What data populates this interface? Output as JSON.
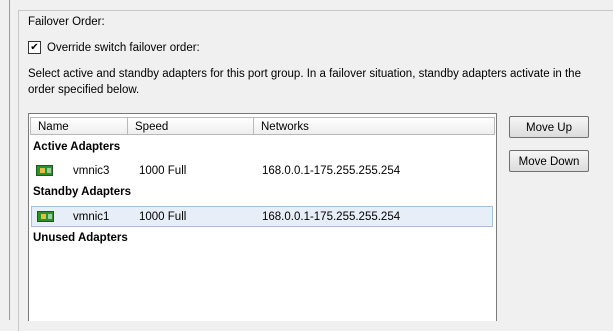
{
  "failover": {
    "title": "Failover Order:",
    "override_checked_glyph": "✔",
    "override_label": "Override switch failover order:",
    "description": "Select active and standby adapters for this port group.  In a failover situation, standby adapters activate  in the order specified below."
  },
  "table": {
    "columns": [
      "Name",
      "Speed",
      "Networks"
    ],
    "groups": {
      "active": "Active Adapters",
      "standby": "Standby Adapters",
      "unused": "Unused Adapters"
    },
    "active_adapters": [
      {
        "name": "vmnic3",
        "speed": "1000 Full",
        "networks": "168.0.0.1-175.255.255.254",
        "icon": "network-card-icon"
      }
    ],
    "standby_adapters": [
      {
        "name": "vmnic1",
        "speed": "1000 Full",
        "networks": "168.0.0.1-175.255.255.254",
        "icon": "network-card-icon",
        "selected": true
      }
    ]
  },
  "buttons": {
    "move_up": "Move Up",
    "move_down": "Move Down"
  }
}
